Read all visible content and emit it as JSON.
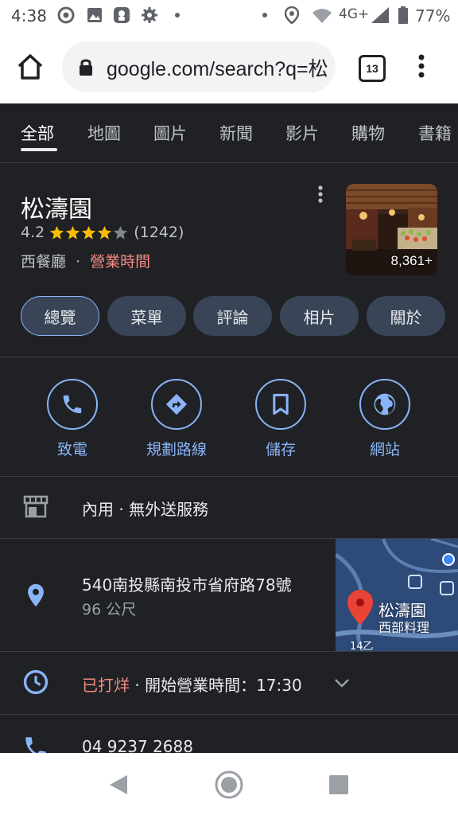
{
  "status_bar": {
    "time": "4:38",
    "network": "4G+",
    "battery": "77%"
  },
  "browser": {
    "url": "google.com/search?q=松",
    "tab_count": "13"
  },
  "search_tabs": [
    "全部",
    "地圖",
    "圖片",
    "新聞",
    "影片",
    "購物",
    "書籍"
  ],
  "place": {
    "name": "松濤園",
    "rating": "4.2",
    "stars": 4.2,
    "review_count": "(1242)",
    "category": "西餐廳",
    "separator": "·",
    "hours_link": "營業時間",
    "photo_count": "8,361+"
  },
  "chips": [
    "總覽",
    "菜單",
    "評論",
    "相片",
    "關於"
  ],
  "actions": [
    {
      "label": "致電",
      "icon": "phone-icon"
    },
    {
      "label": "規劃路線",
      "icon": "directions-icon"
    },
    {
      "label": "儲存",
      "icon": "bookmark-icon"
    },
    {
      "label": "網站",
      "icon": "globe-icon"
    }
  ],
  "service": {
    "text": "內用 · 無外送服務"
  },
  "address": {
    "line": "540南投縣南投市省府路78號",
    "distance": "96 公尺",
    "map_name": "松濤園",
    "map_sub": "西部料理",
    "road": "14乙"
  },
  "hours": {
    "status": "已打烊",
    "detail": "· 開始營業時間：17:30"
  },
  "phone": {
    "number": "04 9237 2688"
  },
  "colors": {
    "accent": "#8ab4f8",
    "closed": "#f28b82",
    "star": "#fbbc04",
    "background": "#202124"
  }
}
